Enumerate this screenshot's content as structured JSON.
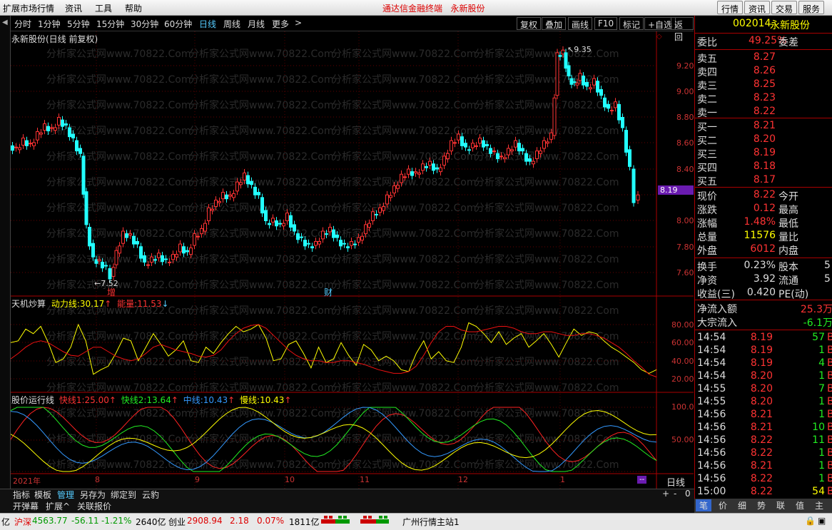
{
  "window": {
    "menu": [
      "扩展市场行情",
      "资讯",
      "工具",
      "帮助"
    ],
    "center_title": "通达信金融终端",
    "stock_title": "永新股份",
    "right_buttons": [
      "行情",
      "资讯",
      "交易",
      "服务"
    ]
  },
  "periods": [
    "分时",
    "1分钟",
    "5分钟",
    "15分钟",
    "30分钟",
    "60分钟",
    "日线",
    "周线",
    "月线",
    "更多"
  ],
  "active_period": "日线",
  "tools": [
    "复权",
    "叠加",
    "画线",
    "F10",
    "标记",
    "+自选",
    "返回"
  ],
  "chart": {
    "header": "永新股份(日线 前复权)",
    "watermark": "分析家公式网www.70822.Com",
    "price_ticks": [
      "9.20",
      "9.00",
      "8.80",
      "8.60",
      "8.40",
      "8.19",
      "8.00",
      "7.80",
      "7.60"
    ],
    "current_price_tag": "8.19",
    "high_mark": "9.35",
    "low_mark": "7.52",
    "event_marks": [
      "增",
      "财"
    ],
    "months": [
      "2021年",
      "8",
      "9",
      "10",
      "11",
      "12",
      "1"
    ],
    "period_label": "日线",
    "ind1": {
      "name": "天机炒算",
      "a_label": "动力线:",
      "a_value": "30.17",
      "b_label": "能量:",
      "b_value": "11.53",
      "ticks": [
        "80.00",
        "60.00",
        "40.00",
        "20.00"
      ]
    },
    "ind2": {
      "name": "股价运行线",
      "l1": "快线1:",
      "v1": "25.00",
      "l2": "快线2:",
      "v2": "13.64",
      "l3": "中线:",
      "v3": "10.43",
      "l4": "慢线:",
      "v4": "10.43",
      "ticks": [
        "100.0",
        "50.00"
      ]
    }
  },
  "quote": {
    "code": "002014",
    "name": "永新股份",
    "webi_label": "委比",
    "webi": "49.25%",
    "weicha_label": "委差",
    "asks": [
      {
        "l": "卖五",
        "p": "8.27"
      },
      {
        "l": "卖四",
        "p": "8.26"
      },
      {
        "l": "卖三",
        "p": "8.25"
      },
      {
        "l": "卖二",
        "p": "8.23"
      },
      {
        "l": "卖一",
        "p": "8.22"
      }
    ],
    "bids": [
      {
        "l": "买一",
        "p": "8.21"
      },
      {
        "l": "买二",
        "p": "8.20"
      },
      {
        "l": "买三",
        "p": "8.19"
      },
      {
        "l": "买四",
        "p": "8.18"
      },
      {
        "l": "买五",
        "p": "8.17"
      }
    ],
    "stats": [
      {
        "l": "现价",
        "v": "8.22",
        "r": "今开"
      },
      {
        "l": "涨跌",
        "v": "0.12",
        "r": "最高"
      },
      {
        "l": "涨幅",
        "v": "1.48%",
        "r": "最低"
      },
      {
        "l": "总量",
        "v": "11576",
        "r": "量比"
      },
      {
        "l": "外盘",
        "v": "6012",
        "r": "内盘"
      }
    ],
    "stats2": [
      {
        "l": "换手",
        "v": "0.23%",
        "r": "股本",
        "x": "5"
      },
      {
        "l": "净资",
        "v": "3.92",
        "r": "流通",
        "x": "5"
      },
      {
        "l": "收益(三)",
        "v": "0.420",
        "r": "PE(动)",
        "x": ""
      }
    ],
    "flow": [
      {
        "l": "净流入额",
        "v": "25.3万"
      },
      {
        "l": "大宗流入",
        "v": "-6.1万"
      }
    ],
    "ticks": [
      {
        "t": "14:54",
        "p": "8.19",
        "v": "57",
        "c": "grn"
      },
      {
        "t": "14:54",
        "p": "8.19",
        "v": "1",
        "c": "grn"
      },
      {
        "t": "14:54",
        "p": "8.19",
        "v": "4",
        "c": "grn"
      },
      {
        "t": "14:54",
        "p": "8.20",
        "v": "1",
        "c": "grn"
      },
      {
        "t": "14:55",
        "p": "8.20",
        "v": "7",
        "c": "grn"
      },
      {
        "t": "14:55",
        "p": "8.20",
        "v": "1",
        "c": "grn"
      },
      {
        "t": "14:56",
        "p": "8.21",
        "v": "1",
        "c": "grn"
      },
      {
        "t": "14:56",
        "p": "8.21",
        "v": "10",
        "c": "grn"
      },
      {
        "t": "14:56",
        "p": "8.22",
        "v": "11",
        "c": "grn"
      },
      {
        "t": "14:56",
        "p": "8.22",
        "v": "1",
        "c": "grn"
      },
      {
        "t": "14:56",
        "p": "8.21",
        "v": "1",
        "c": "grn"
      },
      {
        "t": "14:56",
        "p": "8.22",
        "v": "1",
        "c": "grn"
      },
      {
        "t": "15:00",
        "p": "8.22",
        "v": "54",
        "c": "yel"
      }
    ],
    "panel_buttons": [
      "笔",
      "价",
      "细",
      "势",
      "联",
      "值",
      "主"
    ]
  },
  "bottom": {
    "tabs1": [
      "指标",
      "模板",
      "管理",
      "另存为",
      "绑定到",
      "云豹"
    ],
    "tabs2": [
      "开弹幕",
      "扩展^",
      "关联报价"
    ],
    "zoom": [
      "+",
      "-",
      "0"
    ]
  },
  "status": {
    "prefix": "亿",
    "idx1_name": "沪深",
    "idx1_val": "4563.77",
    "idx1_chg": "-56.11",
    "idx1_pct": "-1.21%",
    "idx1_amt": "2640亿",
    "idx2_name": "创业",
    "idx2_val": "2908.94",
    "idx2_chg": "2.18",
    "idx2_pct": "0.07%",
    "idx2_amt": "1811亿",
    "server": "广州行情主站1"
  }
}
